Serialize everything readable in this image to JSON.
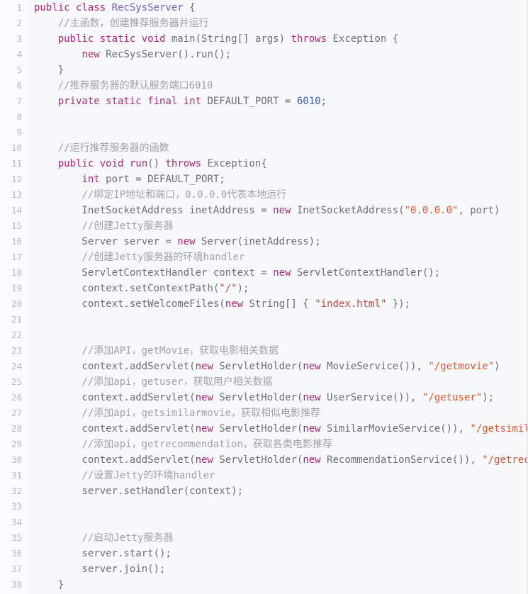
{
  "editor": {
    "language": "java",
    "file_name": "RecSysServer.java",
    "background_color": "#f7f8fa",
    "gutter_color": "#fafbfc",
    "line_number_color": "#b3bac4",
    "default_text_color": "#6e6e78",
    "colors": {
      "keyword": "#b5247d",
      "type": "#7a5fbd",
      "number": "#3b5fc0",
      "string": "#e8552d",
      "comment": "#a0a2ab"
    },
    "first_line": 1,
    "last_line": 38,
    "line_height_px": 22
  },
  "lines": [
    {
      "no": "1",
      "tokens": [
        {
          "t": "k",
          "v": "public class "
        },
        {
          "t": "t",
          "v": "RecSysServer"
        },
        {
          "t": "p",
          "v": " {"
        }
      ]
    },
    {
      "no": "2",
      "tokens": [
        {
          "t": "p",
          "v": "    "
        },
        {
          "t": "c",
          "v": "//主函数，创建推荐服务器并运行"
        }
      ]
    },
    {
      "no": "3",
      "tokens": [
        {
          "t": "p",
          "v": "    "
        },
        {
          "t": "k",
          "v": "public static void "
        },
        {
          "t": "p",
          "v": "main(String[] args) "
        },
        {
          "t": "k",
          "v": "throws "
        },
        {
          "t": "p",
          "v": "Exception {"
        }
      ]
    },
    {
      "no": "4",
      "tokens": [
        {
          "t": "p",
          "v": "        "
        },
        {
          "t": "k",
          "v": "new "
        },
        {
          "t": "p",
          "v": "RecSysServer().run();"
        }
      ]
    },
    {
      "no": "5",
      "tokens": [
        {
          "t": "p",
          "v": "    }"
        }
      ]
    },
    {
      "no": "6",
      "tokens": [
        {
          "t": "p",
          "v": "    "
        },
        {
          "t": "c",
          "v": "//推荐服务器的默认服务端口6010"
        }
      ]
    },
    {
      "no": "7",
      "tokens": [
        {
          "t": "p",
          "v": "    "
        },
        {
          "t": "k",
          "v": "private static final int "
        },
        {
          "t": "p",
          "v": "DEFAULT_PORT = "
        },
        {
          "t": "n",
          "v": "6010"
        },
        {
          "t": "p",
          "v": ";"
        }
      ]
    },
    {
      "no": "8",
      "tokens": [
        {
          "t": "p",
          "v": ""
        }
      ]
    },
    {
      "no": "9",
      "tokens": [
        {
          "t": "p",
          "v": ""
        }
      ]
    },
    {
      "no": "10",
      "tokens": [
        {
          "t": "p",
          "v": "    "
        },
        {
          "t": "c",
          "v": "//运行推荐服务器的函数"
        }
      ]
    },
    {
      "no": "11",
      "tokens": [
        {
          "t": "p",
          "v": "    "
        },
        {
          "t": "k",
          "v": "public void "
        },
        {
          "t": "k",
          "v": "run"
        },
        {
          "t": "p",
          "v": "() "
        },
        {
          "t": "k",
          "v": "throws "
        },
        {
          "t": "p",
          "v": "Exception{"
        }
      ]
    },
    {
      "no": "12",
      "tokens": [
        {
          "t": "p",
          "v": "        "
        },
        {
          "t": "k",
          "v": "int "
        },
        {
          "t": "p",
          "v": "port = DEFAULT_PORT;"
        }
      ]
    },
    {
      "no": "13",
      "tokens": [
        {
          "t": "p",
          "v": "        "
        },
        {
          "t": "c",
          "v": "//绑定IP地址和端口，0.0.0.0代表本地运行"
        }
      ]
    },
    {
      "no": "14",
      "tokens": [
        {
          "t": "p",
          "v": "        InetSocketAddress inetAddress = "
        },
        {
          "t": "k",
          "v": "new "
        },
        {
          "t": "p",
          "v": "InetSocketAddress("
        },
        {
          "t": "s",
          "v": "\"0.0.0.0\""
        },
        {
          "t": "p",
          "v": ", port)"
        }
      ]
    },
    {
      "no": "15",
      "tokens": [
        {
          "t": "p",
          "v": "        "
        },
        {
          "t": "c",
          "v": "//创建Jetty服务器"
        }
      ]
    },
    {
      "no": "16",
      "tokens": [
        {
          "t": "p",
          "v": "        Server server = "
        },
        {
          "t": "k",
          "v": "new "
        },
        {
          "t": "p",
          "v": "Server(inetAddress);"
        }
      ]
    },
    {
      "no": "17",
      "tokens": [
        {
          "t": "p",
          "v": "        "
        },
        {
          "t": "c",
          "v": "//创建Jetty服务器的环境handler"
        }
      ]
    },
    {
      "no": "18",
      "tokens": [
        {
          "t": "p",
          "v": "        ServletContextHandler context = "
        },
        {
          "t": "k",
          "v": "new "
        },
        {
          "t": "p",
          "v": "ServletContextHandler();"
        }
      ]
    },
    {
      "no": "19",
      "tokens": [
        {
          "t": "p",
          "v": "        context.setContextPath("
        },
        {
          "t": "s2",
          "v": "\"/\""
        },
        {
          "t": "p",
          "v": ");"
        }
      ]
    },
    {
      "no": "20",
      "tokens": [
        {
          "t": "p",
          "v": "        context.setWelcomeFiles("
        },
        {
          "t": "k",
          "v": "new "
        },
        {
          "t": "p",
          "v": "String[] { "
        },
        {
          "t": "s2",
          "v": "\"index.html\""
        },
        {
          "t": "p",
          "v": " });"
        }
      ]
    },
    {
      "no": "21",
      "tokens": [
        {
          "t": "p",
          "v": ""
        }
      ]
    },
    {
      "no": "22",
      "tokens": [
        {
          "t": "p",
          "v": ""
        }
      ]
    },
    {
      "no": "23",
      "tokens": [
        {
          "t": "p",
          "v": "        "
        },
        {
          "t": "c",
          "v": "//添加API，getMovie，获取电影相关数据"
        }
      ]
    },
    {
      "no": "24",
      "tokens": [
        {
          "t": "p",
          "v": "        context.addServlet("
        },
        {
          "t": "k",
          "v": "new "
        },
        {
          "t": "p",
          "v": "ServletHolder("
        },
        {
          "t": "k",
          "v": "new "
        },
        {
          "t": "p",
          "v": "MovieService()), "
        },
        {
          "t": "s",
          "v": "\"/getmovie\""
        },
        {
          "t": "p",
          "v": ")"
        }
      ]
    },
    {
      "no": "25",
      "tokens": [
        {
          "t": "p",
          "v": "        "
        },
        {
          "t": "c",
          "v": "//添加api，getuser，获取用户相关数据"
        }
      ]
    },
    {
      "no": "26",
      "tokens": [
        {
          "t": "p",
          "v": "        context.addServlet("
        },
        {
          "t": "k",
          "v": "new "
        },
        {
          "t": "p",
          "v": "ServletHolder("
        },
        {
          "t": "k",
          "v": "new "
        },
        {
          "t": "p",
          "v": "UserService()), "
        },
        {
          "t": "s",
          "v": "\"/getuser\""
        },
        {
          "t": "p",
          "v": ");"
        }
      ]
    },
    {
      "no": "27",
      "tokens": [
        {
          "t": "p",
          "v": "        "
        },
        {
          "t": "c",
          "v": "//添加api，getsimilarmovie，获取相似电影推荐"
        }
      ]
    },
    {
      "no": "28",
      "tokens": [
        {
          "t": "p",
          "v": "        context.addServlet("
        },
        {
          "t": "k",
          "v": "new "
        },
        {
          "t": "p",
          "v": "ServletHolder("
        },
        {
          "t": "k",
          "v": "new "
        },
        {
          "t": "p",
          "v": "SimilarMovieService()), "
        },
        {
          "t": "s",
          "v": "\"/getsimilarmovie\""
        },
        {
          "t": "p",
          "v": ");"
        }
      ]
    },
    {
      "no": "29",
      "tokens": [
        {
          "t": "p",
          "v": "        "
        },
        {
          "t": "c",
          "v": "//添加api，getrecommendation，获取各类电影推荐"
        }
      ]
    },
    {
      "no": "30",
      "tokens": [
        {
          "t": "p",
          "v": "        context.addServlet("
        },
        {
          "t": "k",
          "v": "new "
        },
        {
          "t": "p",
          "v": "ServletHolder("
        },
        {
          "t": "k",
          "v": "new "
        },
        {
          "t": "p",
          "v": "RecommendationService()), "
        },
        {
          "t": "s",
          "v": "\"/getrecommendation\""
        },
        {
          "t": "p",
          "v": ");"
        }
      ]
    },
    {
      "no": "31",
      "tokens": [
        {
          "t": "p",
          "v": "        "
        },
        {
          "t": "c",
          "v": "//设置Jetty的环境handler"
        }
      ]
    },
    {
      "no": "32",
      "tokens": [
        {
          "t": "p",
          "v": "        server.setHandler(context);"
        }
      ]
    },
    {
      "no": "33",
      "tokens": [
        {
          "t": "p",
          "v": ""
        }
      ]
    },
    {
      "no": "34",
      "tokens": [
        {
          "t": "p",
          "v": ""
        }
      ]
    },
    {
      "no": "35",
      "tokens": [
        {
          "t": "p",
          "v": "        "
        },
        {
          "t": "c",
          "v": "//启动Jetty服务器"
        }
      ]
    },
    {
      "no": "36",
      "tokens": [
        {
          "t": "p",
          "v": "        server.start();"
        }
      ]
    },
    {
      "no": "37",
      "tokens": [
        {
          "t": "p",
          "v": "        server.join();"
        }
      ]
    },
    {
      "no": "38",
      "tokens": [
        {
          "t": "p",
          "v": "    }"
        }
      ]
    }
  ]
}
